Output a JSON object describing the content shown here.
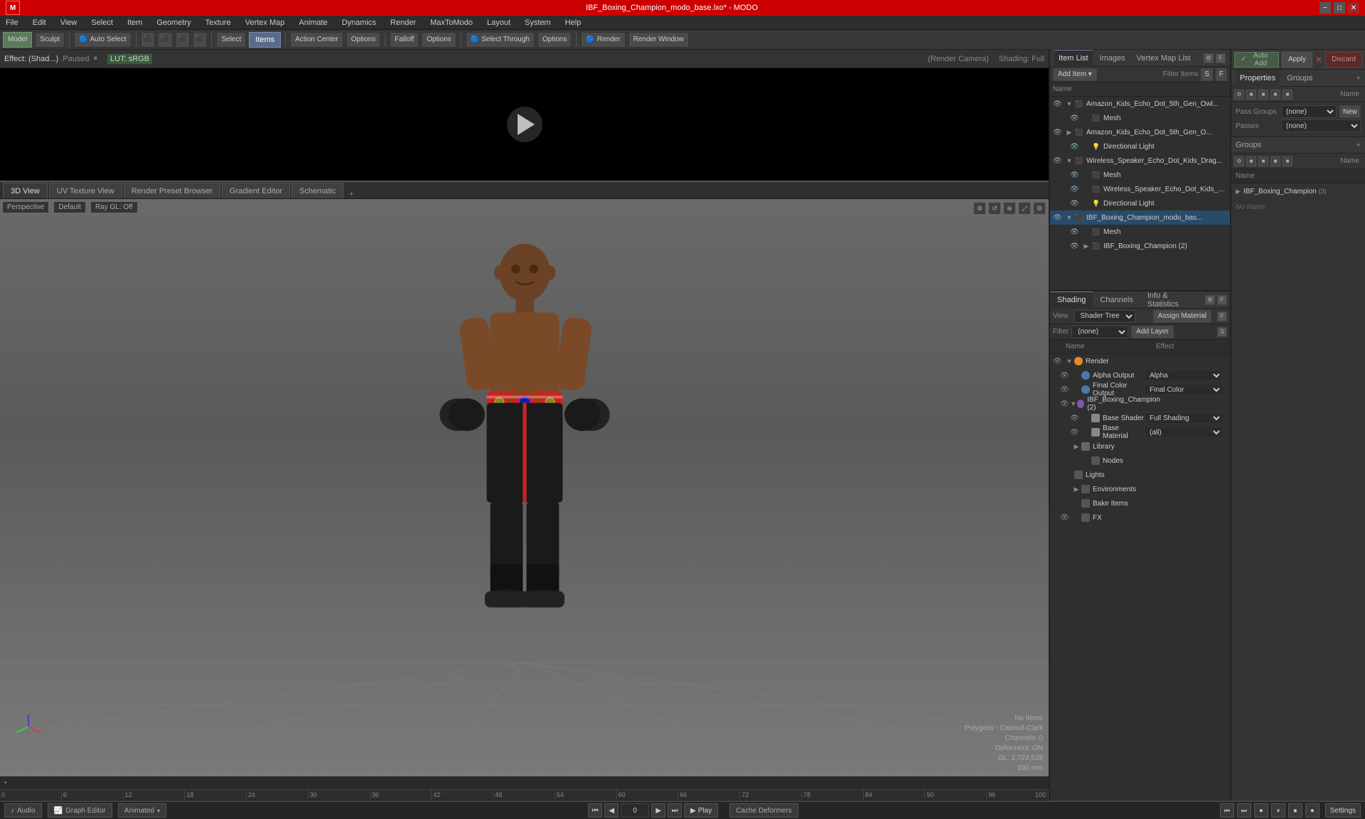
{
  "titlebar": {
    "title": "IBF_Boxing_Champion_modo_base.lxo* - MODO",
    "min": "−",
    "max": "□",
    "close": "✕"
  },
  "menubar": {
    "items": [
      "File",
      "Edit",
      "View",
      "Select",
      "Item",
      "Geometry",
      "Texture",
      "Vertex Map",
      "Animate",
      "Dynamics",
      "Render",
      "MaxToModo",
      "Layout",
      "System",
      "Help"
    ]
  },
  "toolbar": {
    "model_btn": "Model",
    "sculpt_btn": "Sculpt",
    "auto_select": "Auto Select",
    "icons": [
      "⬜",
      "⬜",
      "⬜",
      "⬜"
    ],
    "select_label": "Select",
    "items_label": "Items",
    "action_center": "Action Center",
    "options1": "Options",
    "falloff": "Falloff",
    "options2": "Options",
    "select_through": "Select Through",
    "options3": "Options",
    "render": "Render",
    "render_window": "Render Window"
  },
  "subbar": {
    "effect": "Effect: (Shad...)",
    "state": "Paused",
    "lut": "LUT: sRGB",
    "render_camera": "(Render Camera)",
    "shading": "Shading: Full"
  },
  "tabs": {
    "items": [
      "3D View",
      "UV Texture View",
      "Render Preset Browser",
      "Gradient Editor",
      "Schematic"
    ],
    "active": "3D View",
    "plus": "+"
  },
  "viewport": {
    "label_perspective": "Perspective",
    "label_default": "Default",
    "label_raygl": "Ray GL: Off",
    "stats": {
      "no_items": "No Items",
      "polygons": "Polygons : Catmull-Clark",
      "channels": "Channels: 0",
      "deformers": "Deformers: ON",
      "gl": "GL: 2,724,528",
      "scale": "100 mm"
    }
  },
  "timeline": {
    "marks": [
      "0",
      "6",
      "12",
      "18",
      "24",
      "30",
      "36",
      "42",
      "48",
      "54",
      "60",
      "66",
      "72",
      "78",
      "84",
      "90",
      "96"
    ],
    "end_label": "100"
  },
  "item_list": {
    "panel_tabs": [
      "Item List",
      "Images",
      "Vertex Map List"
    ],
    "active_tab": "Item List",
    "add_item": "Add Item",
    "filter_items": "Filter Items",
    "col_name": "Name",
    "items": [
      {
        "level": 0,
        "name": "Amazon_Kids_Echo_Dot_5th_Gen_Owl...",
        "icon": "⬛",
        "has_children": true,
        "expanded": true,
        "vis": true
      },
      {
        "level": 1,
        "name": "Mesh",
        "icon": "⬛",
        "has_children": false,
        "expanded": false,
        "vis": true
      },
      {
        "level": 0,
        "name": "Amazon_Kids_Echo_Dot_5th_Gen_O...",
        "icon": "⬛",
        "has_children": true,
        "expanded": false,
        "vis": true
      },
      {
        "level": 1,
        "name": "Directional Light",
        "icon": "💡",
        "has_children": false,
        "expanded": false,
        "vis": true
      },
      {
        "level": 0,
        "name": "Wireless_Speaker_Echo_Dot_Kids_Drag...",
        "icon": "⬛",
        "has_children": true,
        "expanded": false,
        "vis": true
      },
      {
        "level": 1,
        "name": "Mesh",
        "icon": "⬛",
        "has_children": false,
        "expanded": false,
        "vis": true
      },
      {
        "level": 1,
        "name": "Wireless_Speaker_Echo_Dot_Kids_Dr...",
        "icon": "⬛",
        "has_children": false,
        "expanded": false,
        "vis": true
      },
      {
        "level": 1,
        "name": "Directional Light",
        "icon": "💡",
        "has_children": false,
        "expanded": false,
        "vis": true
      },
      {
        "level": 0,
        "name": "IBF_Boxing_Champion_modo_bas...",
        "icon": "⬛",
        "has_children": true,
        "expanded": true,
        "vis": true,
        "selected": true
      },
      {
        "level": 1,
        "name": "Mesh",
        "icon": "⬛",
        "has_children": false,
        "expanded": false,
        "vis": true
      },
      {
        "level": 1,
        "name": "IBF_Boxing_Champion (2)",
        "icon": "⬛",
        "has_children": false,
        "expanded": false,
        "vis": true
      }
    ]
  },
  "shading": {
    "tabs": [
      "Shading",
      "Channels",
      "Info & Statistics"
    ],
    "active_tab": "Shading",
    "view_label": "View",
    "view_value": "Shader Tree",
    "assign_material": "Assign Material",
    "filter_label": "Filter",
    "filter_value": "(none)",
    "add_layer": "Add Layer",
    "f_btn": "F",
    "s_btn": "S",
    "col_name": "Name",
    "col_effect": "Effect",
    "layers": [
      {
        "level": 0,
        "name": "Render",
        "icon": "orange",
        "icon_color": "#e8882a",
        "effect": "",
        "effect_val": "",
        "has_children": true,
        "expanded": true
      },
      {
        "level": 1,
        "name": "Alpha Output",
        "icon": "blue",
        "icon_color": "#4a7aaa",
        "effect": "Alpha",
        "effect_val": "Alpha",
        "has_children": false
      },
      {
        "level": 1,
        "name": "Final Color Output",
        "icon": "blue",
        "icon_color": "#4a7aaa",
        "effect": "Final Color",
        "effect_val": "Final Color",
        "has_children": false
      },
      {
        "level": 1,
        "name": "IBF_Boxing_Champion (2)",
        "icon": "purple",
        "icon_color": "#7a5aaa",
        "effect": "",
        "effect_val": "",
        "has_children": true,
        "expanded": true
      },
      {
        "level": 2,
        "name": "Base Shader",
        "icon": "gray",
        "icon_color": "#888",
        "effect": "Full Shading",
        "effect_val": "Full Shading",
        "has_children": false
      },
      {
        "level": 2,
        "name": "Base Material",
        "icon": "gray",
        "icon_color": "#888",
        "effect": "(all)",
        "effect_val": "(all)",
        "has_children": false
      }
    ],
    "extras": [
      {
        "level": 1,
        "name": "Library",
        "icon": "folder",
        "icon_color": "#888",
        "has_children": true,
        "expanded": false
      },
      {
        "level": 2,
        "name": "Nodes",
        "icon": "",
        "icon_color": "#888",
        "has_children": false
      },
      {
        "level": 0,
        "name": "Lights",
        "icon": "",
        "icon_color": "#888",
        "has_children": false
      },
      {
        "level": 1,
        "name": "Environments",
        "icon": "",
        "icon_color": "#888",
        "has_children": true,
        "expanded": false
      },
      {
        "level": 1,
        "name": "Bake Items",
        "icon": "",
        "icon_color": "#888",
        "has_children": false
      },
      {
        "level": 1,
        "name": "FX",
        "icon": "",
        "icon_color": "#888",
        "has_children": false
      }
    ]
  },
  "props": {
    "properties_label": "Properties",
    "groups_label": "Groups",
    "plus": "+",
    "pass_groups": "Pass Groups",
    "pass_select": "(none)",
    "passes": "Passes",
    "passes_select": "(none)",
    "new_btn": "New",
    "col_name": "Name",
    "group_name": "IBF_Boxing_Champion",
    "group_count": "(3)",
    "group_no_name": "No Name"
  },
  "auto_add": {
    "label": "Auto Add",
    "apply": "Apply",
    "discard": "Discard"
  },
  "bottom_bar": {
    "audio": "Audio",
    "graph_editor": "Graph Editor",
    "animated": "Animated",
    "prev_prev": "⏮",
    "prev": "⏴",
    "frame_input": "0",
    "next": "⏵",
    "next_next": "⏭",
    "play": "Play",
    "cache_deformers": "Cache Deformers",
    "settings": "Settings",
    "end": "100"
  }
}
